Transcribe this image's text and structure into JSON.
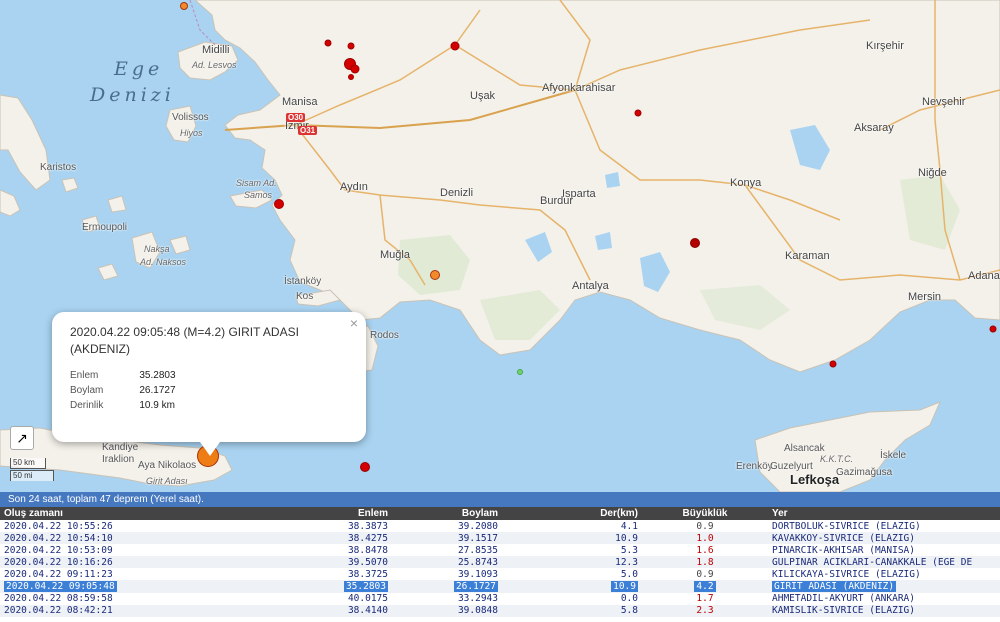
{
  "map": {
    "sea_labels": [
      "Ege",
      "Denizi"
    ],
    "places": [
      {
        "name": "Midilli",
        "cls": "big"
      },
      {
        "name": "Ad. Lesvos",
        "cls": "island"
      },
      {
        "name": "Manisa",
        "cls": "big"
      },
      {
        "name": "İzmir",
        "cls": "big"
      },
      {
        "name": "Uşak",
        "cls": "big"
      },
      {
        "name": "Afyonkarahisar",
        "cls": "big"
      },
      {
        "name": "Kırşehir",
        "cls": "big"
      },
      {
        "name": "Nevşehir",
        "cls": "big"
      },
      {
        "name": "Aksaray",
        "cls": "big"
      },
      {
        "name": "Niğde",
        "cls": "big"
      },
      {
        "name": "Konya",
        "cls": "big"
      },
      {
        "name": "Karaman",
        "cls": "big"
      },
      {
        "name": "Adana",
        "cls": "big"
      },
      {
        "name": "Mersin",
        "cls": "big"
      },
      {
        "name": "Volissos",
        "cls": ""
      },
      {
        "name": "Hiyos",
        "cls": "island"
      },
      {
        "name": "Karistos",
        "cls": ""
      },
      {
        "name": "Aydın",
        "cls": "big"
      },
      {
        "name": "Sisam Ad.",
        "cls": "island"
      },
      {
        "name": "Samos",
        "cls": "island"
      },
      {
        "name": "Denizli",
        "cls": "big"
      },
      {
        "name": "Isparta",
        "cls": "big"
      },
      {
        "name": "Burdur",
        "cls": "big"
      },
      {
        "name": "Ermoupoli",
        "cls": ""
      },
      {
        "name": "Nakşa",
        "cls": "island"
      },
      {
        "name": "Ad. Naksos",
        "cls": "island"
      },
      {
        "name": "Muğla",
        "cls": "big"
      },
      {
        "name": "İstanköy",
        "cls": ""
      },
      {
        "name": "Kos",
        "cls": ""
      },
      {
        "name": "Antalya",
        "cls": "big"
      },
      {
        "name": "Rodos",
        "cls": ""
      },
      {
        "name": "Kandiye",
        "cls": ""
      },
      {
        "name": "Iraklion",
        "cls": ""
      },
      {
        "name": "Aya Nikolaos",
        "cls": ""
      },
      {
        "name": "Girit Adası",
        "cls": "island"
      },
      {
        "name": "Alsancak",
        "cls": ""
      },
      {
        "name": "İskele",
        "cls": ""
      },
      {
        "name": "Erenköy",
        "cls": ""
      },
      {
        "name": "Guzelyurt",
        "cls": ""
      },
      {
        "name": "Gazimağusa",
        "cls": ""
      },
      {
        "name": "K.K.T.C.",
        "cls": "island"
      },
      {
        "name": "Lefkoşa",
        "cls": "cap"
      }
    ],
    "road_shields": [
      "O30",
      "O31"
    ],
    "quake_color_recent": "#d40000",
    "quake_color_selected": "#ef7d15",
    "quake_color_older": "#f08a2a",
    "quake_color_new": "#6fd36f",
    "scale_km": "50 km",
    "scale_mi": "50 mi",
    "fullscreen_icon": "expand-arrow-icon"
  },
  "popup": {
    "title": "2020.04.22 09:05:48 (M=4.2) GIRIT ADASI (AKDENIZ)",
    "close": "×",
    "rows": [
      {
        "label": "Enlem",
        "value": "35.2803"
      },
      {
        "label": "Boylam",
        "value": "26.1727"
      },
      {
        "label": "Derinlik",
        "value": "10.9 km"
      }
    ]
  },
  "info_bar": "Son 24 saat, toplam 47 deprem (Yerel saat).",
  "table": {
    "headers": [
      "Oluş zamanı",
      "Enlem",
      "Boylam",
      "Der(km)",
      "Büyüklük",
      "Yer"
    ],
    "selected_index": 5,
    "rows": [
      [
        "2020.04.22 10:55:26",
        "38.3873",
        "39.2080",
        "4.1",
        "0.9",
        "DORTBOLUK-SIVRICE (ELAZIG)"
      ],
      [
        "2020.04.22 10:54:10",
        "38.4275",
        "39.1517",
        "10.9",
        "1.0",
        "KAVAKKOY-SIVRICE (ELAZIG)"
      ],
      [
        "2020.04.22 10:53:09",
        "38.8478",
        "27.8535",
        "5.3",
        "1.6",
        "PINARCIK-AKHISAR (MANISA)"
      ],
      [
        "2020.04.22 10:16:26",
        "39.5070",
        "25.8743",
        "12.3",
        "1.8",
        "GULPINAR ACIKLARI-CANAKKALE (EGE DE"
      ],
      [
        "2020.04.22 09:11:23",
        "38.3725",
        "39.1093",
        "5.0",
        "0.9",
        "KILICKAYA-SIVRICE (ELAZIG)"
      ],
      [
        "2020.04.22 09:05:48",
        "35.2803",
        "26.1727",
        "10.9",
        "4.2",
        "GIRIT ADASI (AKDENIZ)"
      ],
      [
        "2020.04.22 08:59:58",
        "40.0175",
        "33.2943",
        "0.0",
        "1.7",
        "AHMETADIL-AKYURT (ANKARA)"
      ],
      [
        "2020.04.22 08:42:21",
        "38.4140",
        "39.0848",
        "5.8",
        "2.3",
        "KAMISLIK-SIVRICE (ELAZIG)"
      ]
    ]
  }
}
